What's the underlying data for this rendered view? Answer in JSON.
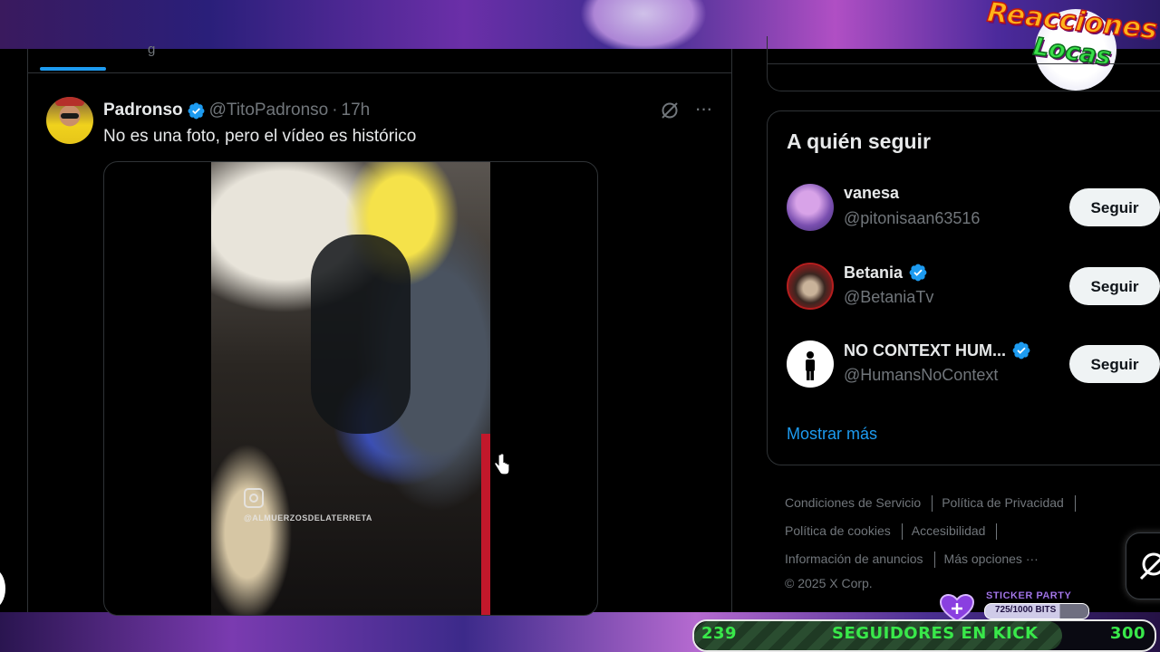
{
  "stream_overlay": {
    "logo_line1": "Reacciones",
    "logo_line2": "Locas",
    "sticker_party": {
      "title": "STICKER PARTY",
      "bits": "725/1000 BITS",
      "progress": 0.725
    },
    "kick_goal": {
      "start": "239",
      "label": "SEGUIDORES EN KICK",
      "end": "300",
      "progress": 0.8
    }
  },
  "timeline": {
    "tab_partial_label": "g",
    "post": {
      "author": "Padronso",
      "handle": "@TitoPadronso",
      "separator": "·",
      "time": "17h",
      "text": "No es una foto, pero el vídeo es histórico",
      "media_watermark": "@ALMUERZOSDELATERRETA"
    }
  },
  "sidebar": {
    "who_to_follow": {
      "title": "A quién seguir",
      "accounts": [
        {
          "name": "vanesa",
          "handle": "@pitonisaan63516",
          "verified": false,
          "button": "Seguir"
        },
        {
          "name": "Betania",
          "handle": "@BetaniaTv",
          "verified": true,
          "button": "Seguir"
        },
        {
          "name": "NO CONTEXT HUM...",
          "handle": "@HumansNoContext",
          "verified": true,
          "button": "Seguir"
        }
      ],
      "show_more": "Mostrar más"
    },
    "footer": {
      "terms": "Condiciones de Servicio",
      "privacy": "Política de Privacidad",
      "cookies": "Política de cookies",
      "accessibility": "Accesibilidad",
      "ads_info": "Información de anuncios",
      "more": "Más opciones ···",
      "copyright": "© 2025 X Corp."
    }
  },
  "colors": {
    "accent": "#1d9bf0",
    "background": "#000000",
    "text_primary": "#e7e9ea",
    "text_secondary": "#71767b",
    "kick_green": "#39e84a"
  }
}
